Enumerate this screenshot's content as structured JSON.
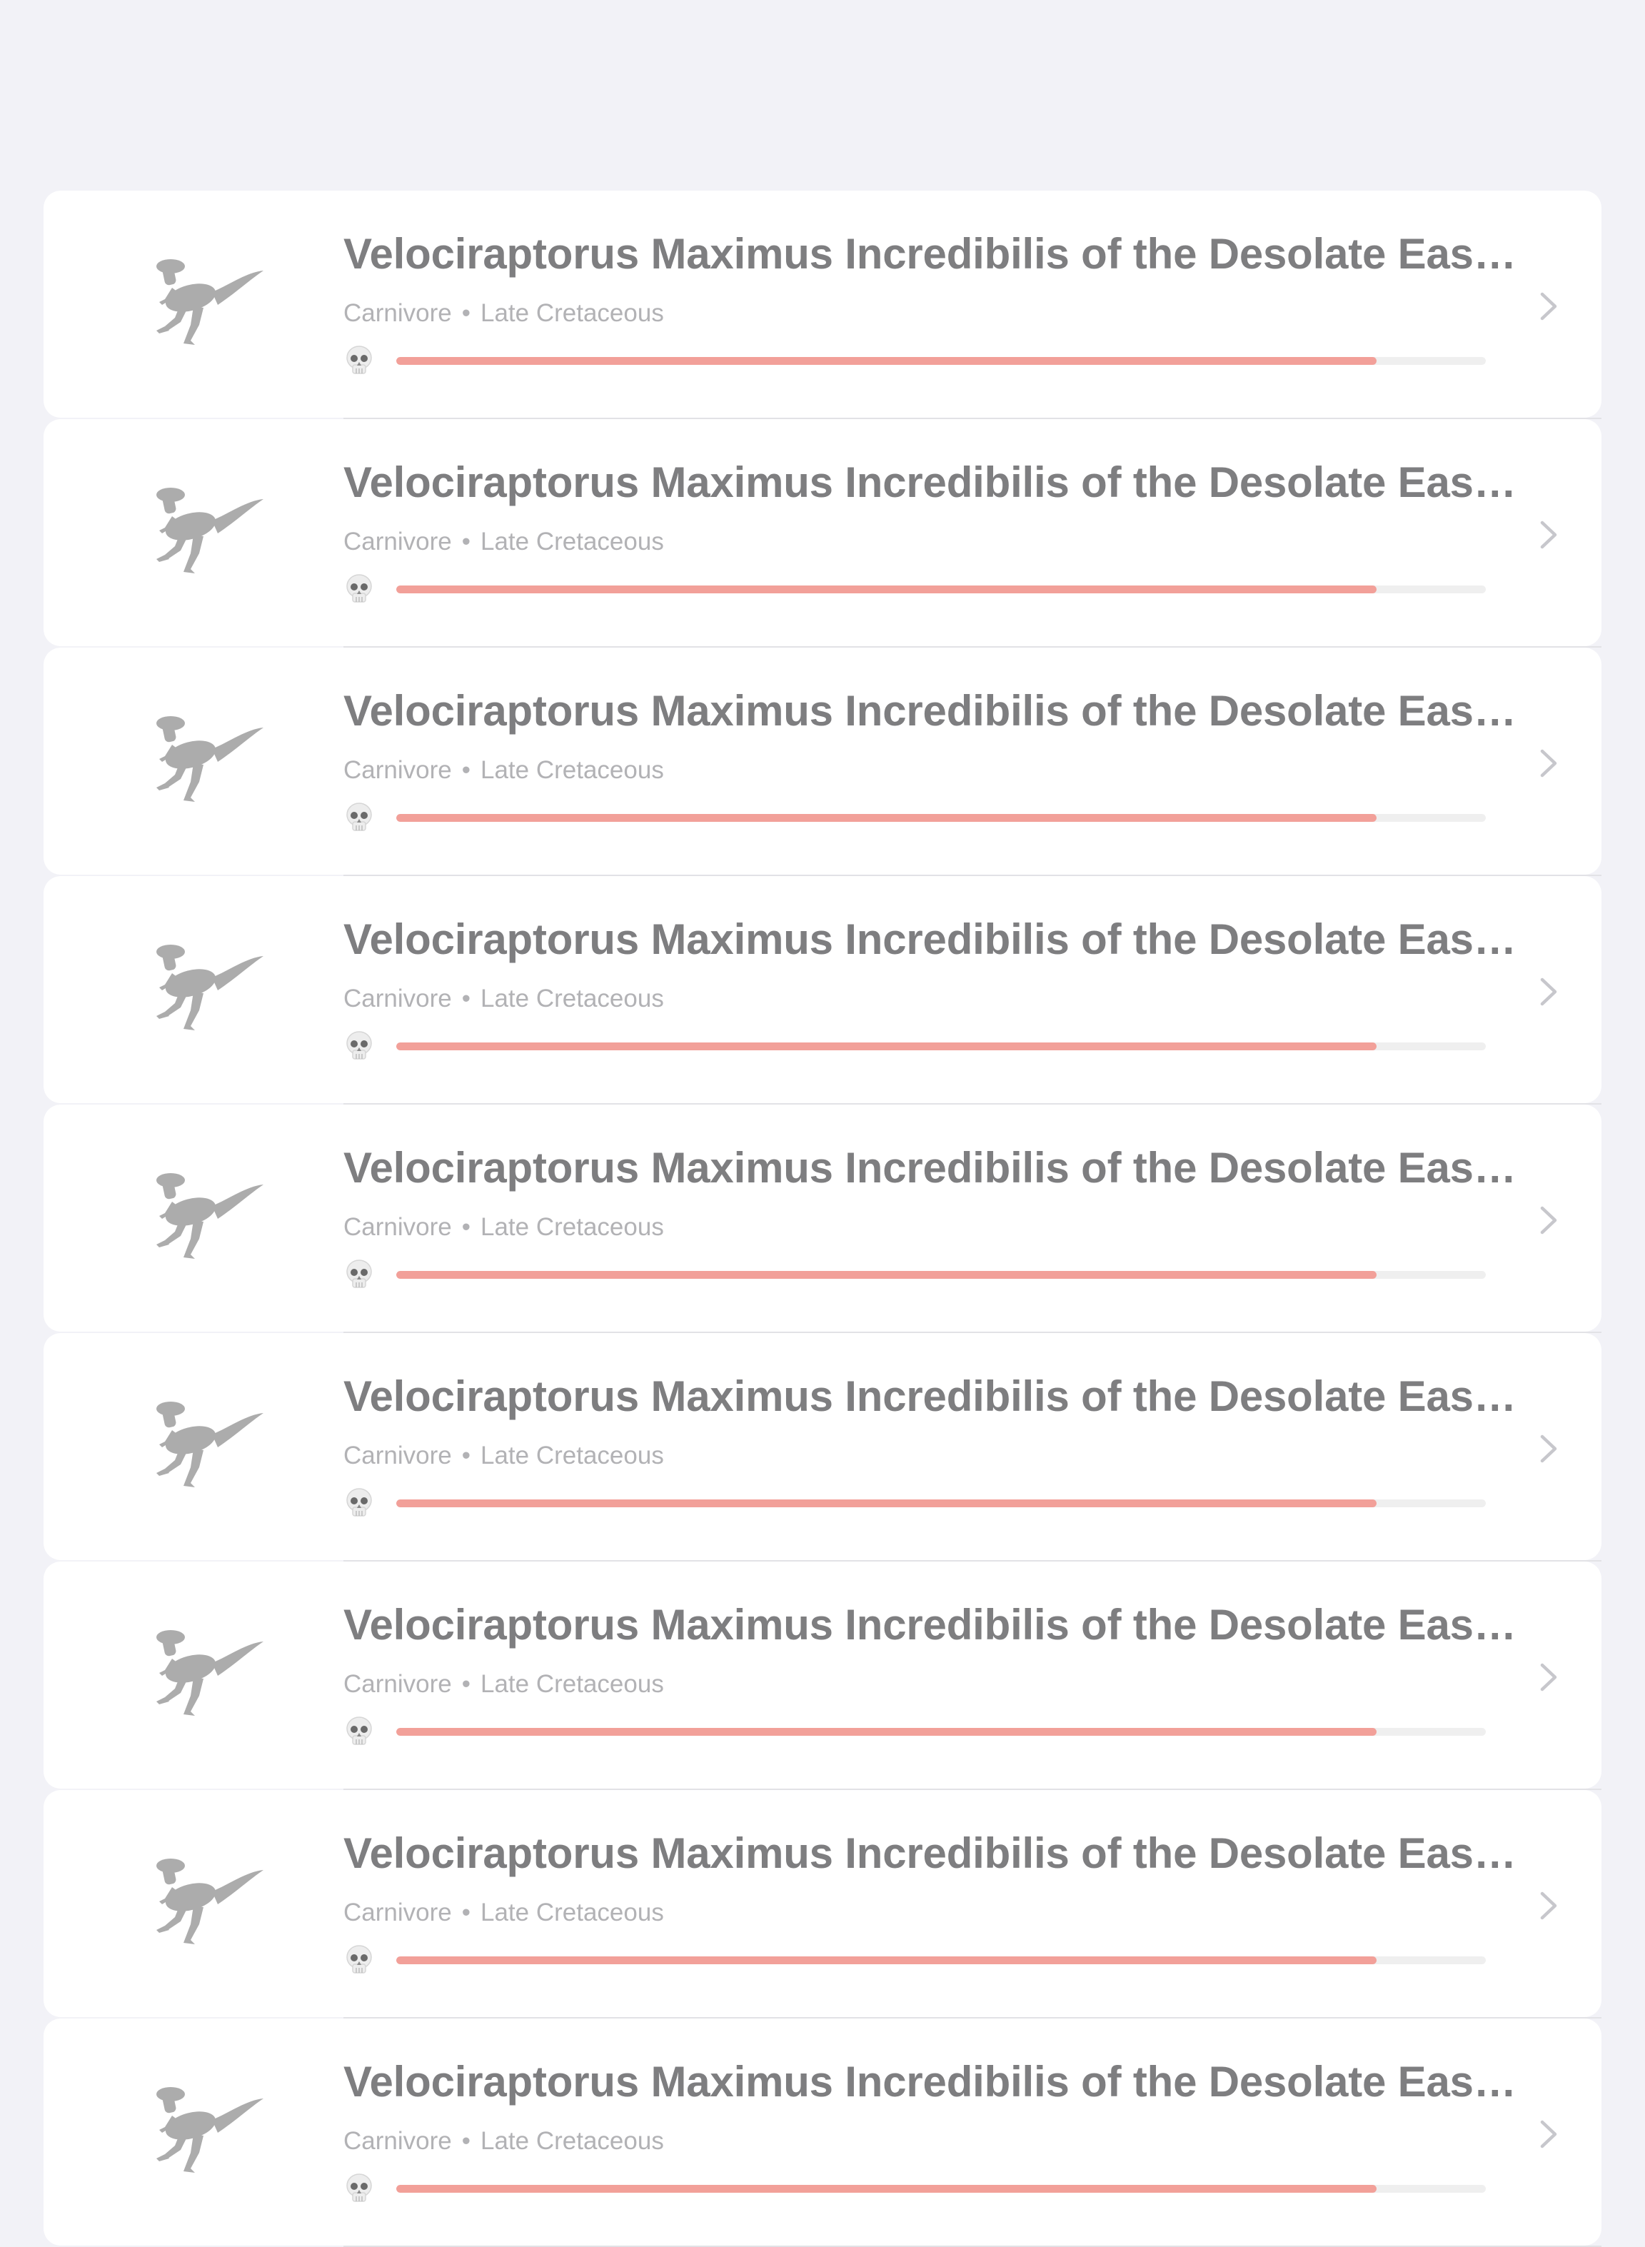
{
  "colors": {
    "background": "#f2f2f7",
    "card": "#ffffff",
    "title_text": "#7e7e80",
    "subtitle_text": "#b2b2b5",
    "progress_fill": "#f2a099",
    "progress_track": "#efefef",
    "icon_gray": "#acacac"
  },
  "list": {
    "items": [
      {
        "title": "Velociraptorus Maximus Incredibilis of the Desolate Eastern Plains",
        "diet": "Carnivore",
        "separator": "•",
        "period": "Late Cretaceous",
        "icon": "dinosaur-icon",
        "status_icon": "skull-icon",
        "progress": 0.9
      },
      {
        "title": "Velociraptorus Maximus Incredibilis of the Desolate Eastern Plains",
        "diet": "Carnivore",
        "separator": "•",
        "period": "Late Cretaceous",
        "icon": "dinosaur-icon",
        "status_icon": "skull-icon",
        "progress": 0.9
      },
      {
        "title": "Velociraptorus Maximus Incredibilis of the Desolate Eastern Plains",
        "diet": "Carnivore",
        "separator": "•",
        "period": "Late Cretaceous",
        "icon": "dinosaur-icon",
        "status_icon": "skull-icon",
        "progress": 0.9
      },
      {
        "title": "Velociraptorus Maximus Incredibilis of the Desolate Eastern Plains",
        "diet": "Carnivore",
        "separator": "•",
        "period": "Late Cretaceous",
        "icon": "dinosaur-icon",
        "status_icon": "skull-icon",
        "progress": 0.9
      },
      {
        "title": "Velociraptorus Maximus Incredibilis of the Desolate Eastern Plains",
        "diet": "Carnivore",
        "separator": "•",
        "period": "Late Cretaceous",
        "icon": "dinosaur-icon",
        "status_icon": "skull-icon",
        "progress": 0.9
      },
      {
        "title": "Velociraptorus Maximus Incredibilis of the Desolate Eastern Plains",
        "diet": "Carnivore",
        "separator": "•",
        "period": "Late Cretaceous",
        "icon": "dinosaur-icon",
        "status_icon": "skull-icon",
        "progress": 0.9
      },
      {
        "title": "Velociraptorus Maximus Incredibilis of the Desolate Eastern Plains",
        "diet": "Carnivore",
        "separator": "•",
        "period": "Late Cretaceous",
        "icon": "dinosaur-icon",
        "status_icon": "skull-icon",
        "progress": 0.9
      },
      {
        "title": "Velociraptorus Maximus Incredibilis of the Desolate Eastern Plains",
        "diet": "Carnivore",
        "separator": "•",
        "period": "Late Cretaceous",
        "icon": "dinosaur-icon",
        "status_icon": "skull-icon",
        "progress": 0.9
      },
      {
        "title": "Velociraptorus Maximus Incredibilis of the Desolate Eastern Plains",
        "diet": "Carnivore",
        "separator": "•",
        "period": "Late Cretaceous",
        "icon": "dinosaur-icon",
        "status_icon": "skull-icon",
        "progress": 0.9
      }
    ]
  }
}
